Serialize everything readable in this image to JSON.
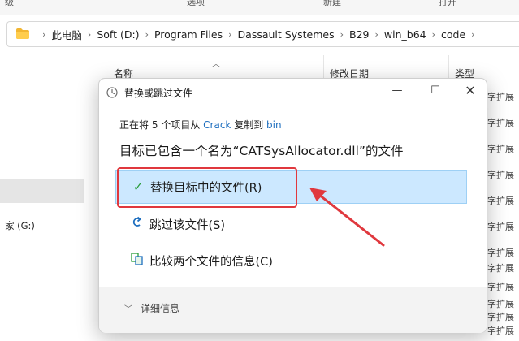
{
  "ribbon": {
    "items": [
      "级",
      "选项",
      "新建",
      "打开"
    ]
  },
  "address_bar": {
    "icon": "folder-icon",
    "crumbs": [
      "此电脑",
      "Soft (D:)",
      "Program Files",
      "Dassault Systemes",
      "B29",
      "win_b64",
      "code"
    ]
  },
  "nav": {
    "drive_label": "家 (G:)"
  },
  "columns": {
    "name": "名称",
    "date": "修改日期",
    "type": "类型"
  },
  "type_cells": [
    "字扩展",
    "字扩展",
    "字扩展",
    "字扩展",
    "字扩展",
    "字扩展",
    "字扩展",
    "字扩展",
    "字扩展",
    "字扩展",
    "字扩展",
    "字扩展"
  ],
  "dialog": {
    "title": "替换或跳过文件",
    "controls": {
      "minimize": "—",
      "maximize": "☐",
      "close": "✕"
    },
    "progress": {
      "prefix": "正在将",
      "count": "5",
      "mid": "个项目从",
      "source": "Crack",
      "to": "复制到",
      "dest": "bin"
    },
    "heading": "目标已包含一个名为“CATSysAllocator.dll”的文件",
    "options": {
      "replace": "替换目标中的文件(R)",
      "skip": "跳过该文件(S)",
      "compare": "比较两个文件的信息(C)"
    },
    "details": "详细信息"
  },
  "colors": {
    "highlight": "#cce8ff",
    "annotation": "#e0383e",
    "link": "#1f6fbf",
    "check": "#2a9d3a"
  }
}
